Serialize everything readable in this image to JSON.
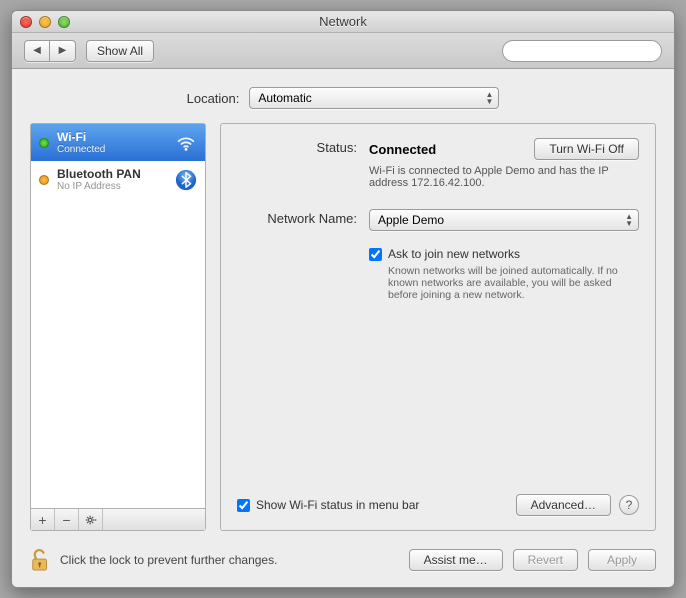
{
  "window": {
    "title": "Network"
  },
  "toolbar": {
    "showall": "Show All",
    "search_placeholder": ""
  },
  "location": {
    "label": "Location:",
    "value": "Automatic"
  },
  "sidebar": {
    "items": [
      {
        "name": "Wi-Fi",
        "status": "Connected",
        "dot": "green",
        "icon": "wifi",
        "selected": true
      },
      {
        "name": "Bluetooth PAN",
        "status": "No IP Address",
        "dot": "orange",
        "icon": "bluetooth",
        "selected": false
      }
    ]
  },
  "detail": {
    "status_label": "Status:",
    "status_value": "Connected",
    "turnoff": "Turn Wi-Fi Off",
    "status_desc": "Wi-Fi is connected to Apple Demo and has the IP address 172.16.42.100.",
    "network_label": "Network Name:",
    "network_value": "Apple Demo",
    "ask_join": "Ask to join new networks",
    "ask_join_checked": true,
    "ask_desc": "Known networks will be joined automatically. If no known networks are available, you will be asked before joining a new network.",
    "show_menubar": "Show Wi-Fi status in menu bar",
    "show_menubar_checked": true,
    "advanced": "Advanced…"
  },
  "bottom": {
    "lock_text": "Click the lock to prevent further changes.",
    "assist": "Assist me…",
    "revert": "Revert",
    "apply": "Apply"
  }
}
